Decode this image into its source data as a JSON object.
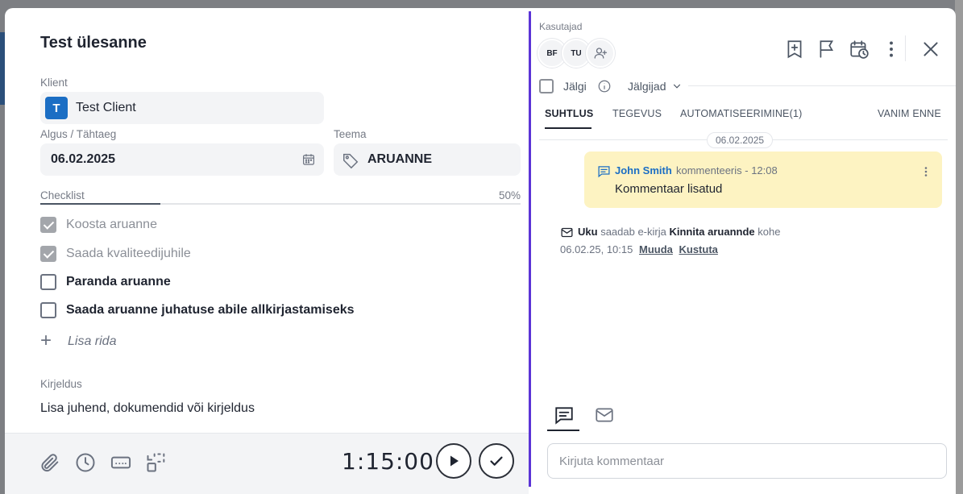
{
  "task": {
    "title": "Test ülesanne",
    "client_label": "Klient",
    "client_initial": "T",
    "client_name": "Test Client",
    "date_label": "Algus / Tähtaeg",
    "date_value": "06.02.2025",
    "theme_label": "Teema",
    "theme_value": "ARUANNE",
    "checklist_label": "Checklist",
    "checklist_percent": "50%",
    "checklist_progress": 0.5,
    "checklist": [
      {
        "text": "Koosta aruanne",
        "checked": true
      },
      {
        "text": "Saada kvaliteedijuhile",
        "checked": true
      },
      {
        "text": "Paranda aruanne",
        "checked": false
      },
      {
        "text": "Saada aruanne juhatuse abile allkirjastamiseks",
        "checked": false
      }
    ],
    "add_row_label": "Lisa rida",
    "description_label": "Kirjeldus",
    "description": "Lisa juhend, dokumendid või kirjeldus"
  },
  "footer": {
    "timer": "1:15:00",
    "icons": [
      "paperclip-icon",
      "clock-icon",
      "keyboard-icon",
      "checklist-toggle-icon"
    ]
  },
  "side": {
    "users_label": "Kasutajad",
    "users": [
      "BF",
      "TU"
    ],
    "follow_label": "Jälgi",
    "followers_label": "Jälgijad",
    "tabs": [
      "SUHTLUS",
      "TEGEVUS",
      "AUTOMATISEERIMINE(1)",
      "VANIM ENNE"
    ],
    "date_separator": "06.02.2025",
    "comment": {
      "author": "John Smith",
      "verb": "kommenteeris - 12:08",
      "body": "Kommentaar lisatud"
    },
    "email_event": {
      "actor": "Uku",
      "verb": "saadab e-kirja",
      "subject": "Kinnita aruannde",
      "suffix": "kohe",
      "timestamp": "06.02.25, 10:15",
      "edit": "Muuda",
      "delete": "Kustuta"
    },
    "composer_placeholder": "Kirjuta kommentaar"
  },
  "colors": {
    "accent": "#5b34d6",
    "client_badge": "#1b6ec4",
    "comment_bg": "#fdf3c2",
    "link": "#1b6ec4"
  }
}
